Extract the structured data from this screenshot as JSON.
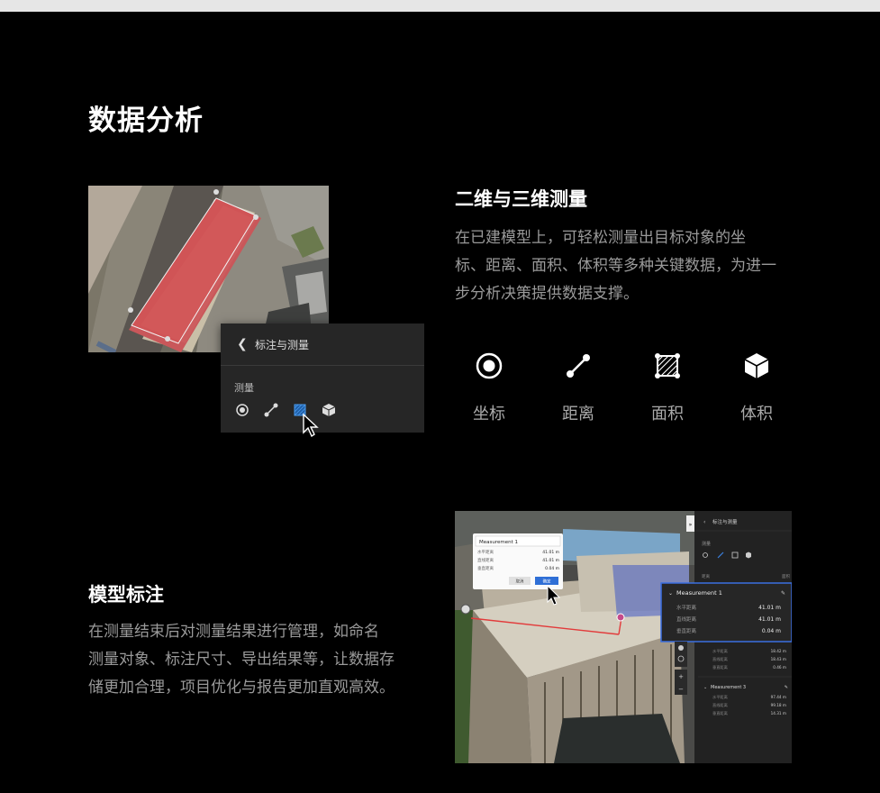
{
  "page": {
    "title": "数据分析"
  },
  "section_measure": {
    "heading": "二维与三维测量",
    "description_lines": [
      "在已建模型上，可轻松测量出目标对象的坐",
      "标、距离、面积、体积等多种关键数据，为进一",
      "步分析决策提供数据支撑。"
    ],
    "features": [
      {
        "icon": "point-icon",
        "label": "坐标"
      },
      {
        "icon": "distance-icon",
        "label": "距离"
      },
      {
        "icon": "area-icon",
        "label": "面积"
      },
      {
        "icon": "volume-icon",
        "label": "体积"
      }
    ],
    "panel": {
      "title": "标注与测量",
      "section_label": "测量"
    }
  },
  "section_annotate": {
    "heading": "模型标注",
    "description_lines": [
      "在测量结束后对测量结果进行管理，如命名",
      "测量对象、标注尺寸、导出结果等，让数据存",
      "储更加合理，项目优化与报告更加直观高效。"
    ],
    "screenshot": {
      "dialog_title": "Measurement 1",
      "dialog_rows": [
        {
          "label": "水平距离",
          "value": "41.01 m"
        },
        {
          "label": "直线距离",
          "value": "41.01 m"
        },
        {
          "label": "垂直距离",
          "value": "0.04 m"
        }
      ],
      "cancel_label": "取消",
      "confirm_label": "确定",
      "side_title": "标注与测量",
      "side_section": "测量",
      "list_label_left": "距离",
      "list_label_right": "面积",
      "card1": {
        "title": "Measurement 1",
        "rows": [
          {
            "label": "水平距离",
            "value": "41.01 m"
          },
          {
            "label": "直线距离",
            "value": "41.01 m"
          },
          {
            "label": "垂直距离",
            "value": "0.04 m"
          }
        ]
      },
      "card2": {
        "rows": [
          {
            "label": "水平距离",
            "value": "18.42 m"
          },
          {
            "label": "直线距离",
            "value": "18.43 m"
          },
          {
            "label": "垂直距离",
            "value": "0.46 m"
          }
        ]
      },
      "card3": {
        "title": "Measurement 3",
        "rows": [
          {
            "label": "水平距离",
            "value": "97.44 m"
          },
          {
            "label": "直线距离",
            "value": "99.18 m"
          },
          {
            "label": "垂直距离",
            "value": "14.31 m"
          }
        ]
      }
    }
  },
  "colors": {
    "accent": "#2f6fd6",
    "roof_red": "#c9575a",
    "line_red": "#e23b3b"
  }
}
